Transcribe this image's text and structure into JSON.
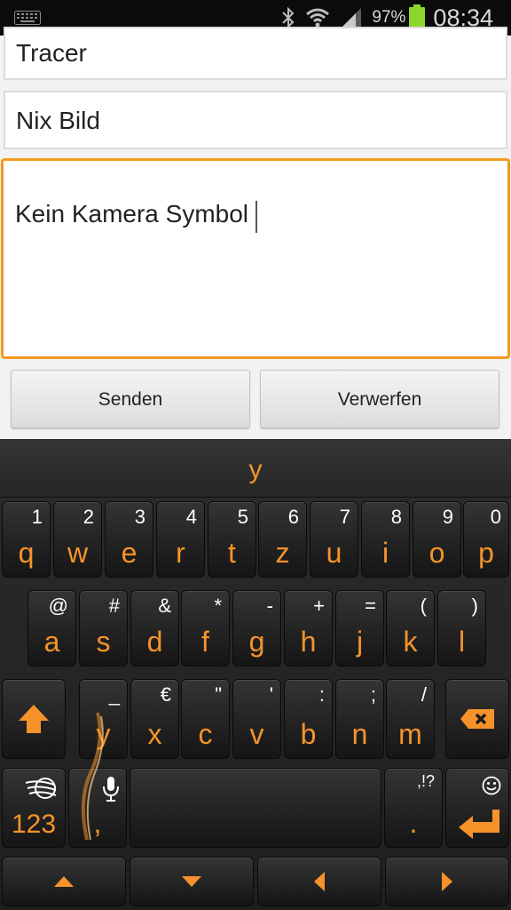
{
  "status_bar": {
    "battery_percent": "97%",
    "time": "08:34",
    "icons": [
      "keyboard-icon",
      "bluetooth-icon",
      "wifi-icon",
      "signal-icon",
      "battery-icon"
    ]
  },
  "form": {
    "tracer_value": "Tracer",
    "subject_value": "Nix Bild",
    "message_value": "Kein Kamera Symbol",
    "send_label": "Senden",
    "discard_label": "Verwerfen"
  },
  "keyboard": {
    "prediction": "y",
    "accent_color": "#f5932a",
    "rows": [
      [
        {
          "pri": "q",
          "sec": "1"
        },
        {
          "pri": "w",
          "sec": "2"
        },
        {
          "pri": "e",
          "sec": "3"
        },
        {
          "pri": "r",
          "sec": "4"
        },
        {
          "pri": "t",
          "sec": "5"
        },
        {
          "pri": "z",
          "sec": "6"
        },
        {
          "pri": "u",
          "sec": "7"
        },
        {
          "pri": "i",
          "sec": "8"
        },
        {
          "pri": "o",
          "sec": "9"
        },
        {
          "pri": "p",
          "sec": "0"
        }
      ],
      [
        {
          "pri": "a",
          "sec": "@"
        },
        {
          "pri": "s",
          "sec": "#"
        },
        {
          "pri": "d",
          "sec": "&"
        },
        {
          "pri": "f",
          "sec": "*"
        },
        {
          "pri": "g",
          "sec": "-"
        },
        {
          "pri": "h",
          "sec": "+"
        },
        {
          "pri": "j",
          "sec": "="
        },
        {
          "pri": "k",
          "sec": "("
        },
        {
          "pri": "l",
          "sec": ")"
        }
      ],
      [
        {
          "pri": "y",
          "sec": "_"
        },
        {
          "pri": "x",
          "sec": "€"
        },
        {
          "pri": "c",
          "sec": "\""
        },
        {
          "pri": "v",
          "sec": "'"
        },
        {
          "pri": "b",
          "sec": ":"
        },
        {
          "pri": "n",
          "sec": ";"
        },
        {
          "pri": "m",
          "sec": "/"
        }
      ]
    ],
    "numbers_label": "123",
    "comma_label": ",",
    "period_label": ".",
    "period_sec": ",!?",
    "icons": [
      "shift-icon",
      "backspace-icon",
      "swype-logo-icon",
      "microphone-icon",
      "smiley-icon",
      "enter-icon",
      "arrow-up-icon",
      "arrow-down-icon",
      "arrow-left-icon",
      "arrow-right-icon"
    ]
  }
}
